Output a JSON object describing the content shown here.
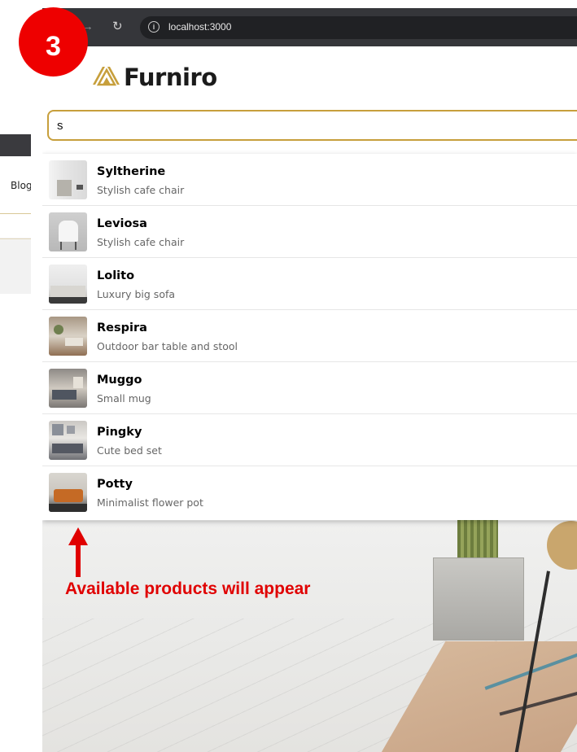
{
  "step_badge": "3",
  "browser": {
    "url": "localhost:3000",
    "info_icon": "i"
  },
  "background_window": {
    "nav_partial": "Blog"
  },
  "brand": {
    "name": "Furniro",
    "logo_color": "#c79f3c"
  },
  "search": {
    "value": "s",
    "border_color": "#c79f3c"
  },
  "results": [
    {
      "name": "Syltherine",
      "description": "Stylish cafe chair",
      "thumb_icon": "cafe-chair-photo"
    },
    {
      "name": "Leviosa",
      "description": "Stylish cafe chair",
      "thumb_icon": "white-chair-photo"
    },
    {
      "name": "Lolito",
      "description": "Luxury big sofa",
      "thumb_icon": "sofa-photo"
    },
    {
      "name": "Respira",
      "description": "Outdoor bar table and stool",
      "thumb_icon": "living-room-photo"
    },
    {
      "name": "Muggo",
      "description": "Small mug",
      "thumb_icon": "living-room-photo"
    },
    {
      "name": "Pingky",
      "description": "Cute bed set",
      "thumb_icon": "living-room-photo"
    },
    {
      "name": "Potty",
      "description": "Minimalist flower pot",
      "thumb_icon": "orange-sofa-photo"
    }
  ],
  "annotation": {
    "text": "Available products will appear",
    "color": "#e00000"
  }
}
